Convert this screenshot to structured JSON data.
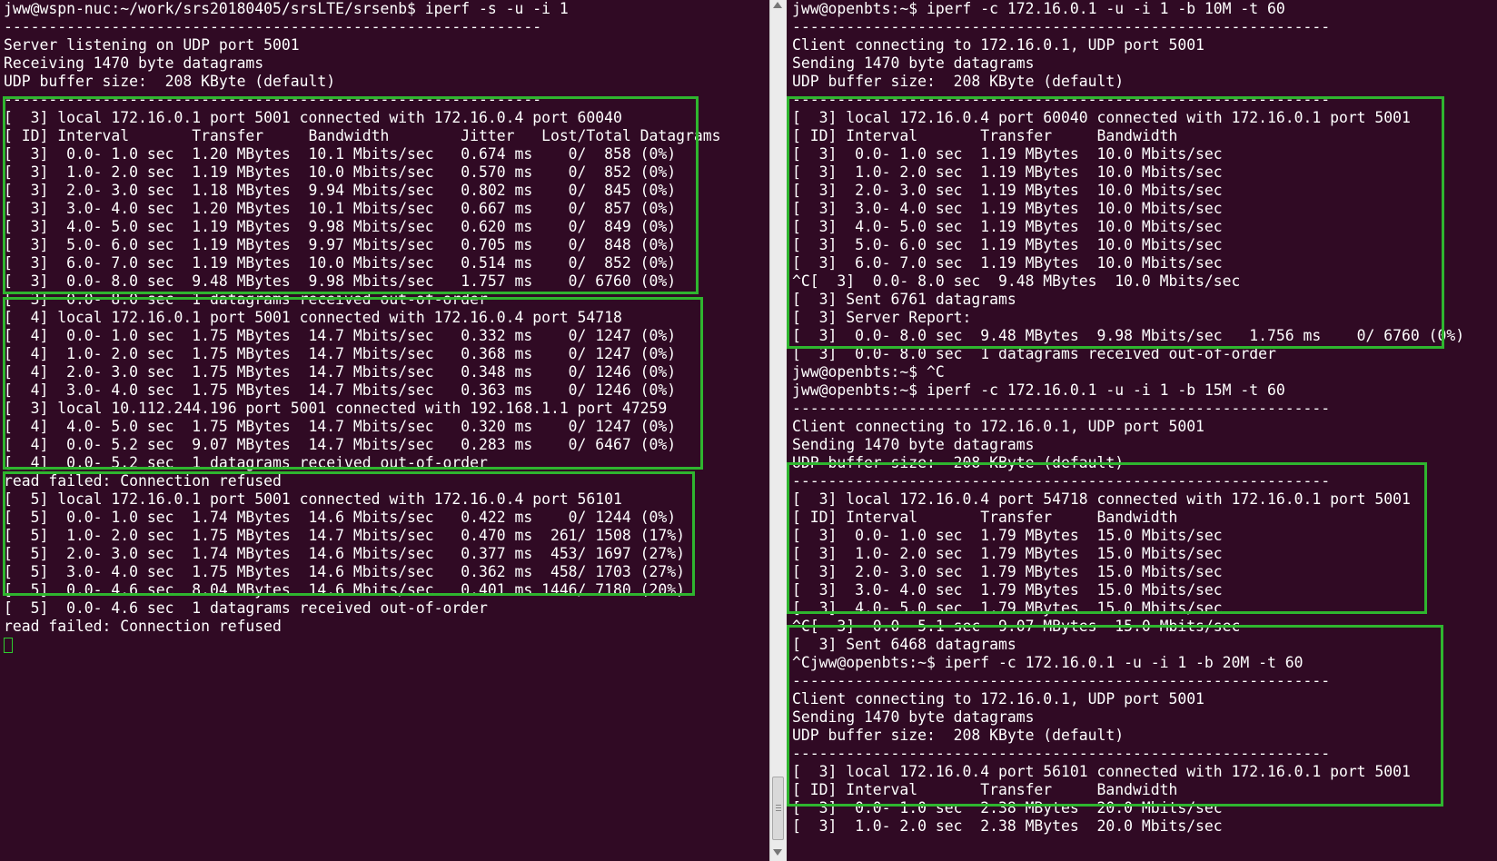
{
  "left_terminal": {
    "lines": [
      "jww@wspn-nuc:~/work/srs20180405/srsLTE/srsenb$ iperf -s -u -i 1",
      "------------------------------------------------------------",
      "Server listening on UDP port 5001",
      "Receiving 1470 byte datagrams",
      "UDP buffer size:  208 KByte (default)",
      "------------------------------------------------------------",
      "[  3] local 172.16.0.1 port 5001 connected with 172.16.0.4 port 60040",
      "[ ID] Interval       Transfer     Bandwidth        Jitter   Lost/Total Datagrams",
      "[  3]  0.0- 1.0 sec  1.20 MBytes  10.1 Mbits/sec   0.674 ms    0/  858 (0%)",
      "[  3]  1.0- 2.0 sec  1.19 MBytes  10.0 Mbits/sec   0.570 ms    0/  852 (0%)",
      "[  3]  2.0- 3.0 sec  1.18 MBytes  9.94 Mbits/sec   0.802 ms    0/  845 (0%)",
      "[  3]  3.0- 4.0 sec  1.20 MBytes  10.1 Mbits/sec   0.667 ms    0/  857 (0%)",
      "[  3]  4.0- 5.0 sec  1.19 MBytes  9.98 Mbits/sec   0.620 ms    0/  849 (0%)",
      "[  3]  5.0- 6.0 sec  1.19 MBytes  9.97 Mbits/sec   0.705 ms    0/  848 (0%)",
      "[  3]  6.0- 7.0 sec  1.19 MBytes  10.0 Mbits/sec   0.514 ms    0/  852 (0%)",
      "[  3]  0.0- 8.0 sec  9.48 MBytes  9.98 Mbits/sec   1.757 ms    0/ 6760 (0%)",
      "[  3]  0.0- 8.0 sec  1 datagrams received out-of-order",
      "[  4] local 172.16.0.1 port 5001 connected with 172.16.0.4 port 54718",
      "[  4]  0.0- 1.0 sec  1.75 MBytes  14.7 Mbits/sec   0.332 ms    0/ 1247 (0%)",
      "[  4]  1.0- 2.0 sec  1.75 MBytes  14.7 Mbits/sec   0.368 ms    0/ 1247 (0%)",
      "[  4]  2.0- 3.0 sec  1.75 MBytes  14.7 Mbits/sec   0.348 ms    0/ 1246 (0%)",
      "[  4]  3.0- 4.0 sec  1.75 MBytes  14.7 Mbits/sec   0.363 ms    0/ 1246 (0%)",
      "[  3] local 10.112.244.196 port 5001 connected with 192.168.1.1 port 47259",
      "[  4]  4.0- 5.0 sec  1.75 MBytes  14.7 Mbits/sec   0.320 ms    0/ 1247 (0%)",
      "[  4]  0.0- 5.2 sec  9.07 MBytes  14.7 Mbits/sec   0.283 ms    0/ 6467 (0%)",
      "[  4]  0.0- 5.2 sec  1 datagrams received out-of-order",
      "read failed: Connection refused",
      "[  5] local 172.16.0.1 port 5001 connected with 172.16.0.4 port 56101",
      "[  5]  0.0- 1.0 sec  1.74 MBytes  14.6 Mbits/sec   0.422 ms    0/ 1244 (0%)",
      "[  5]  1.0- 2.0 sec  1.75 MBytes  14.7 Mbits/sec   0.470 ms  261/ 1508 (17%)",
      "[  5]  2.0- 3.0 sec  1.74 MBytes  14.6 Mbits/sec   0.377 ms  453/ 1697 (27%)",
      "[  5]  3.0- 4.0 sec  1.75 MBytes  14.6 Mbits/sec   0.362 ms  458/ 1703 (27%)",
      "[  5]  0.0- 4.6 sec  8.04 MBytes  14.6 Mbits/sec   0.401 ms 1446/ 7180 (20%)",
      "[  5]  0.0- 4.6 sec  1 datagrams received out-of-order",
      "read failed: Connection refused"
    ]
  },
  "right_terminal": {
    "lines": [
      "jww@openbts:~$ iperf -c 172.16.0.1 -u -i 1 -b 10M -t 60",
      "------------------------------------------------------------",
      "Client connecting to 172.16.0.1, UDP port 5001",
      "Sending 1470 byte datagrams",
      "UDP buffer size:  208 KByte (default)",
      "------------------------------------------------------------",
      "[  3] local 172.16.0.4 port 60040 connected with 172.16.0.1 port 5001",
      "[ ID] Interval       Transfer     Bandwidth",
      "[  3]  0.0- 1.0 sec  1.19 MBytes  10.0 Mbits/sec",
      "[  3]  1.0- 2.0 sec  1.19 MBytes  10.0 Mbits/sec",
      "[  3]  2.0- 3.0 sec  1.19 MBytes  10.0 Mbits/sec",
      "[  3]  3.0- 4.0 sec  1.19 MBytes  10.0 Mbits/sec",
      "[  3]  4.0- 5.0 sec  1.19 MBytes  10.0 Mbits/sec",
      "[  3]  5.0- 6.0 sec  1.19 MBytes  10.0 Mbits/sec",
      "[  3]  6.0- 7.0 sec  1.19 MBytes  10.0 Mbits/sec",
      "^C[  3]  0.0- 8.0 sec  9.48 MBytes  10.0 Mbits/sec",
      "[  3] Sent 6761 datagrams",
      "[  3] Server Report:",
      "[  3]  0.0- 8.0 sec  9.48 MBytes  9.98 Mbits/sec   1.756 ms    0/ 6760 (0%)",
      "[  3]  0.0- 8.0 sec  1 datagrams received out-of-order",
      "jww@openbts:~$ ^C",
      "jww@openbts:~$ iperf -c 172.16.0.1 -u -i 1 -b 15M -t 60",
      "------------------------------------------------------------",
      "Client connecting to 172.16.0.1, UDP port 5001",
      "Sending 1470 byte datagrams",
      "UDP buffer size:  208 KByte (default)",
      "------------------------------------------------------------",
      "[  3] local 172.16.0.4 port 54718 connected with 172.16.0.1 port 5001",
      "[ ID] Interval       Transfer     Bandwidth",
      "[  3]  0.0- 1.0 sec  1.79 MBytes  15.0 Mbits/sec",
      "[  3]  1.0- 2.0 sec  1.79 MBytes  15.0 Mbits/sec",
      "[  3]  2.0- 3.0 sec  1.79 MBytes  15.0 Mbits/sec",
      "[  3]  3.0- 4.0 sec  1.79 MBytes  15.0 Mbits/sec",
      "[  3]  4.0- 5.0 sec  1.79 MBytes  15.0 Mbits/sec",
      "^C[  3]  0.0- 5.1 sec  9.07 MBytes  15.0 Mbits/sec",
      "[  3] Sent 6468 datagrams",
      "^Cjww@openbts:~$ iperf -c 172.16.0.1 -u -i 1 -b 20M -t 60",
      "------------------------------------------------------------",
      "Client connecting to 172.16.0.1, UDP port 5001",
      "Sending 1470 byte datagrams",
      "UDP buffer size:  208 KByte (default)",
      "------------------------------------------------------------",
      "[  3] local 172.16.0.4 port 56101 connected with 172.16.0.1 port 5001",
      "[ ID] Interval       Transfer     Bandwidth",
      "[  3]  0.0- 1.0 sec  2.38 MBytes  20.0 Mbits/sec",
      "[  3]  1.0- 2.0 sec  2.38 MBytes  20.0 Mbits/sec"
    ]
  },
  "colors": {
    "terminal_background": "#300a24",
    "terminal_text": "#ffffff",
    "highlight_box": "#2fb52f"
  }
}
